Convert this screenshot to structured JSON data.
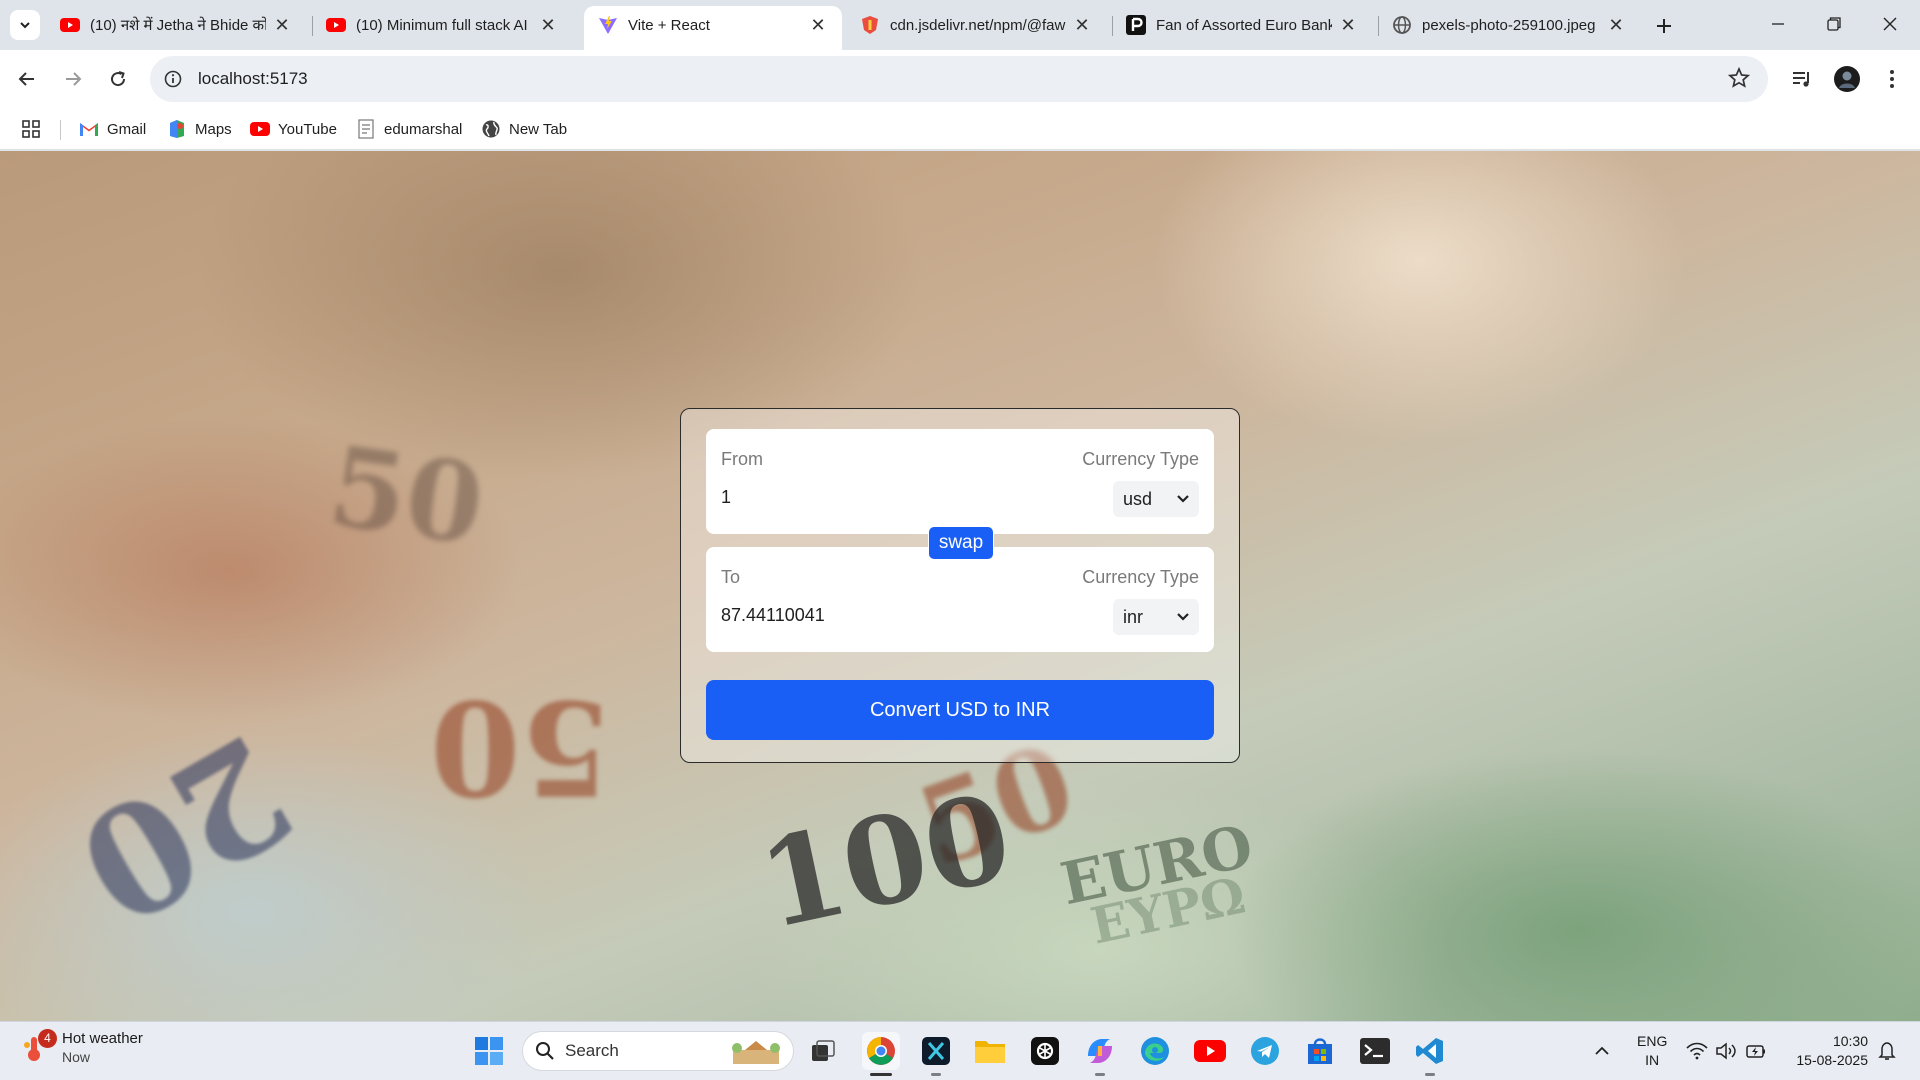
{
  "browser": {
    "tabs": [
      {
        "title": "(10) नशे में Jetha ने Bhide को",
        "favicon": "youtube-icon"
      },
      {
        "title": "(10) Minimum full stack AI",
        "favicon": "youtube-icon"
      },
      {
        "title": "Vite + React",
        "favicon": "vite-icon",
        "active": true
      },
      {
        "title": "cdn.jsdelivr.net/npm/@faw",
        "favicon": "jsdelivr-icon"
      },
      {
        "title": "Fan of Assorted Euro Banki",
        "favicon": "pexels-icon"
      },
      {
        "title": "pexels-photo-259100.jpeg",
        "favicon": "globe-icon"
      }
    ],
    "url": "localhost:5173",
    "bookmarks": [
      {
        "label": "Gmail",
        "icon": "gmail-icon"
      },
      {
        "label": "Maps",
        "icon": "maps-icon"
      },
      {
        "label": "YouTube",
        "icon": "youtube-icon"
      },
      {
        "label": "edumarshal",
        "icon": "document-icon"
      },
      {
        "label": "New Tab",
        "icon": "globe-icon"
      }
    ]
  },
  "converter": {
    "from": {
      "label": "From",
      "currency_label": "Currency Type",
      "amount": "1",
      "currency": "usd"
    },
    "to": {
      "label": "To",
      "currency_label": "Currency Type",
      "amount": "87.44110041",
      "currency": "inr"
    },
    "swap_label": "swap",
    "convert_label": "Convert USD to INR",
    "accent_color": "#1a5ff5"
  },
  "background": {
    "decor_texts": [
      "50",
      "50",
      "20",
      "50",
      "100",
      "EURO",
      "ΕΥΡΩ"
    ]
  },
  "taskbar": {
    "weather": {
      "title": "Hot weather",
      "subtitle": "Now",
      "badge": "4"
    },
    "search_label": "Search",
    "language": {
      "line1": "ENG",
      "line2": "IN"
    },
    "clock": {
      "time": "10:30",
      "date": "15-08-2025"
    }
  }
}
